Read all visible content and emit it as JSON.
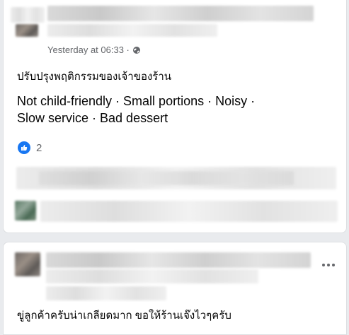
{
  "post": {
    "timestamp": "Yesterday at 06:33 ·",
    "title": "ปรับปรุงพฤติกรรมของเจ้าของร้าน",
    "tags": {
      "line1": "Not child-friendly · Small portions · Noisy ·",
      "line2": "Slow service · Bad dessert"
    },
    "reaction_count": "2",
    "icons": {
      "privacy": "globe-icon",
      "reaction": "like-icon"
    }
  },
  "comment": {
    "text": "ขู่ลูกค้าครับน่าเกลียดมาก ขอให้ร้านเจ๊งไวๆครับ",
    "icons": {
      "menu": "more-options-icon"
    }
  },
  "colors": {
    "accent": "#1877f2",
    "secondary_text": "#65676b",
    "primary_text": "#050505",
    "background": "#e9ebee"
  }
}
